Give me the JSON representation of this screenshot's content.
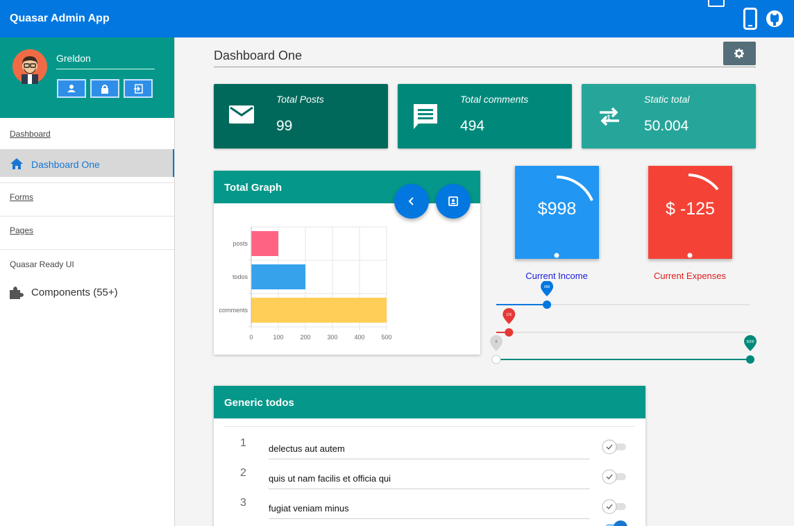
{
  "app": {
    "title": "Quasar Admin App"
  },
  "header_icons": [
    "mail-icon",
    "phone-icon",
    "github-icon"
  ],
  "profile": {
    "name": "Greldon",
    "buttons": [
      "person-icon",
      "lock-icon",
      "logout-icon"
    ]
  },
  "sidebar": {
    "dashboard_section": "Dashboard",
    "active_item": "Dashboard One",
    "forms": "Forms",
    "pages": "Pages",
    "ready_ui_label": "Quasar Ready UI",
    "components": "Components (55+)"
  },
  "main": {
    "page_title": "Dashboard One",
    "stats": [
      {
        "label": "Total Posts",
        "value": "99",
        "color": "#00695c",
        "icon": "mail-icon"
      },
      {
        "label": "Total comments",
        "value": "494",
        "color": "#00897b",
        "icon": "comment-icon"
      },
      {
        "label": "Static total",
        "value": "50.004",
        "color": "#26a69a",
        "icon": "repeat-one-icon"
      }
    ],
    "graph": {
      "title": "Total Graph"
    },
    "income": {
      "value": "$998",
      "caption": "Current Income",
      "color": "#2196f3",
      "caption_color": "#1a1adb"
    },
    "expenses": {
      "value": "$ -125",
      "caption": "Current Expenses",
      "color": "#f44336",
      "caption_color": "#e21b1b"
    },
    "sliders": {
      "income": {
        "value": 998,
        "min": 0,
        "max": 5000,
        "label": "998",
        "color": "#0277e0"
      },
      "expense": {
        "value": 125,
        "min": 0,
        "max": 2500,
        "label": "125",
        "color": "#e53935"
      },
      "range": {
        "min": 0,
        "max": 5000,
        "min_label": "0",
        "max_label": "5000",
        "color": "#00897b"
      }
    },
    "todos": {
      "title": "Generic todos",
      "items": [
        {
          "n": "1",
          "text": "delectus aut autem",
          "done": false
        },
        {
          "n": "2",
          "text": "quis ut nam facilis et officia qui",
          "done": false
        },
        {
          "n": "3",
          "text": "fugiat veniam minus",
          "done": false
        }
      ]
    }
  },
  "chart_data": {
    "type": "bar",
    "orientation": "horizontal",
    "categories": [
      "posts",
      "todos",
      "comments"
    ],
    "values": [
      100,
      200,
      500
    ],
    "colors": [
      "#ff6384",
      "#36a2eb",
      "#ffce56"
    ],
    "xlim": [
      0,
      500
    ],
    "xticks": [
      "0",
      "100",
      "200",
      "300",
      "400",
      "500"
    ],
    "grid": true,
    "legend": "none"
  }
}
